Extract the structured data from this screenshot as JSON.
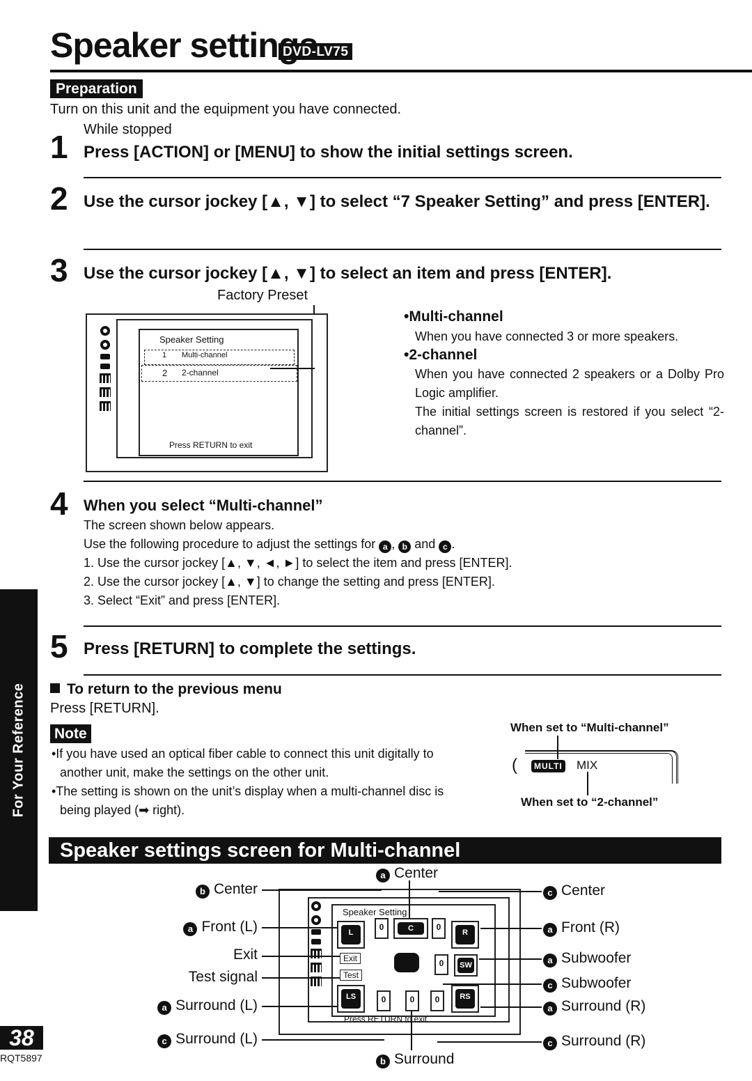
{
  "page": {
    "title": "Speaker settings",
    "model_badge": "DVD-LV75",
    "preparation": {
      "badge": "Preparation",
      "text": "Turn on this unit and the equipment you have connected."
    },
    "steps": [
      {
        "number": "1",
        "sub": "While stopped",
        "heading": "Press [ACTION] or [MENU] to show the initial settings screen."
      },
      {
        "number": "2",
        "heading": "Use the cursor jockey [▲, ▼] to select “7 Speaker Setting” and press [ENTER]."
      },
      {
        "number": "3",
        "heading": "Use the cursor jockey [▲, ▼] to select an item and press [ENTER]."
      },
      {
        "number": "4",
        "heading": "When you select “Multi-channel”"
      },
      {
        "number": "5",
        "heading": "Press [RETURN] to complete the settings."
      }
    ],
    "factory_preset_label": "Factory Preset",
    "initial_screen": {
      "title": "Speaker Setting",
      "items": [
        {
          "num": "1",
          "label": "Multi-channel"
        },
        {
          "num": "2",
          "label": "2-channel"
        }
      ],
      "footer": "Press RETURN to exit"
    },
    "options": [
      {
        "heading": "•Multi-channel",
        "text": "When you have connected 3 or more speakers."
      },
      {
        "heading": "•2-channel",
        "text": "When you have connected 2 speakers or a Dolby Pro Logic amplifier.",
        "text2": "The initial settings screen is restored if you select “2-channel”."
      }
    ],
    "step4_body": {
      "line1": "The screen shown below appears.",
      "line2_pre": "Use the following procedure to adjust the settings for ",
      "line2_mid1": ", ",
      "line2_mid2": " and ",
      "line2_post": ".",
      "markers": [
        "a",
        "b",
        "c"
      ],
      "procedures": [
        "1. Use the cursor jockey [▲, ▼, ◄, ►] to select the item and press [ENTER].",
        "2. Use the cursor jockey [▲, ▼] to change the setting and press [ENTER].",
        "3. Select “Exit” and press [ENTER]."
      ]
    },
    "return_menu": {
      "heading": "To return to the previous menu",
      "text": "Press [RETURN]."
    },
    "note": {
      "badge": "Note",
      "items": [
        "•If you have used an optical fiber cable to connect this unit digitally to another unit, make the settings on the other unit.",
        "•The setting is shown on the unit’s display when a multi-channel disc is being played (➡ right)."
      ]
    },
    "display_diagram": {
      "top_label": "When set to “Multi-channel”",
      "multi_indicator": "MULTI",
      "mix_indicator": "MIX",
      "bottom_label": "When set to “2-channel”"
    },
    "side_tab": "For Your Reference",
    "page_number": "38",
    "doc_code": "RQT5897"
  },
  "multichannel_section": {
    "banner": "Speaker settings screen for Multi-channel",
    "screen": {
      "title": "Speaker Setting",
      "footer": "Press RETURN to exit",
      "exit_button": "Exit",
      "test_button": "Test",
      "speakers": {
        "front_l": "L",
        "center": "C",
        "front_r": "R",
        "subwoofer": "SW",
        "surround_l": "LS",
        "surround_r": "RS"
      },
      "values": {
        "center_left": "0",
        "center_right": "0",
        "sub": "0",
        "surr_l": "0",
        "surr_mid": "0",
        "surr_r": "0"
      }
    },
    "labels_top": {
      "marker": "a",
      "text": "Center"
    },
    "labels_bottom": {
      "marker": "b",
      "text": "Surround"
    },
    "labels_left": [
      {
        "marker": "b",
        "text": "Center"
      },
      {
        "marker": "a",
        "text": "Front (L)"
      },
      {
        "marker": "",
        "text": "Exit"
      },
      {
        "marker": "",
        "text": "Test signal"
      },
      {
        "marker": "a",
        "text": "Surround (L)"
      },
      {
        "marker": "c",
        "text": "Surround (L)"
      }
    ],
    "labels_right": [
      {
        "marker": "c",
        "text": "Center"
      },
      {
        "marker": "a",
        "text": "Front (R)"
      },
      {
        "marker": "a",
        "text": "Subwoofer"
      },
      {
        "marker": "c",
        "text": "Subwoofer"
      },
      {
        "marker": "a",
        "text": "Surround (R)"
      },
      {
        "marker": "c",
        "text": "Surround (R)"
      }
    ]
  }
}
